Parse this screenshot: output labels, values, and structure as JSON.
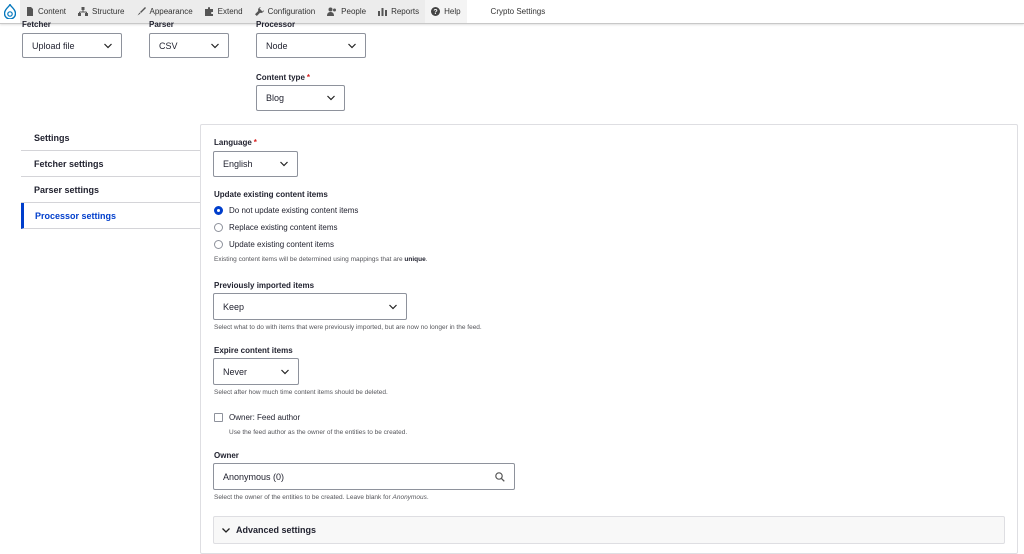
{
  "toolbar": {
    "items": [
      {
        "label": "Content",
        "icon": "file-icon"
      },
      {
        "label": "Structure",
        "icon": "sitemap-icon"
      },
      {
        "label": "Appearance",
        "icon": "brush-icon"
      },
      {
        "label": "Extend",
        "icon": "puzzle-icon"
      },
      {
        "label": "Configuration",
        "icon": "wrench-icon"
      },
      {
        "label": "People",
        "icon": "people-icon"
      },
      {
        "label": "Reports",
        "icon": "bar-chart-icon"
      },
      {
        "label": "Help",
        "icon": "question-icon"
      },
      {
        "label": "Crypto Settings",
        "icon": ""
      }
    ]
  },
  "top_fields": {
    "fetcher": {
      "label": "Fetcher",
      "value": "Upload file"
    },
    "parser": {
      "label": "Parser",
      "value": "CSV"
    },
    "processor": {
      "label": "Processor",
      "value": "Node"
    },
    "content_type": {
      "label": "Content type",
      "required": "*",
      "value": "Blog"
    }
  },
  "tabs": [
    {
      "label": "Settings",
      "active": false
    },
    {
      "label": "Fetcher settings",
      "active": false
    },
    {
      "label": "Parser settings",
      "active": false
    },
    {
      "label": "Processor settings",
      "active": true
    }
  ],
  "processor_settings": {
    "language": {
      "label": "Language",
      "required": "*",
      "value": "English"
    },
    "update_existing": {
      "label": "Update existing content items",
      "options": [
        {
          "label": "Do not update existing content items",
          "checked": true
        },
        {
          "label": "Replace existing content items",
          "checked": false
        },
        {
          "label": "Update existing content items",
          "checked": false
        }
      ],
      "description_prefix": "Existing content items will be determined using mappings that are ",
      "description_strong": "unique",
      "description_suffix": "."
    },
    "previously_imported": {
      "label": "Previously imported items",
      "value": "Keep",
      "description": "Select what to do with items that were previously imported, but are now no longer in the feed."
    },
    "expire": {
      "label": "Expire content items",
      "value": "Never",
      "description": "Select after how much time content items should be deleted."
    },
    "owner_feed_author": {
      "label": "Owner: Feed author",
      "checked": false,
      "description": "Use the feed author as the owner of the entities to be created."
    },
    "owner": {
      "label": "Owner",
      "value": "Anonymous (0)",
      "description_prefix": "Select the owner of the entities to be created. Leave blank for ",
      "description_em": "Anonymous",
      "description_suffix": "."
    },
    "advanced": {
      "label": "Advanced settings"
    }
  },
  "colors": {
    "accent": "#003ecc",
    "required": "#d72222"
  }
}
